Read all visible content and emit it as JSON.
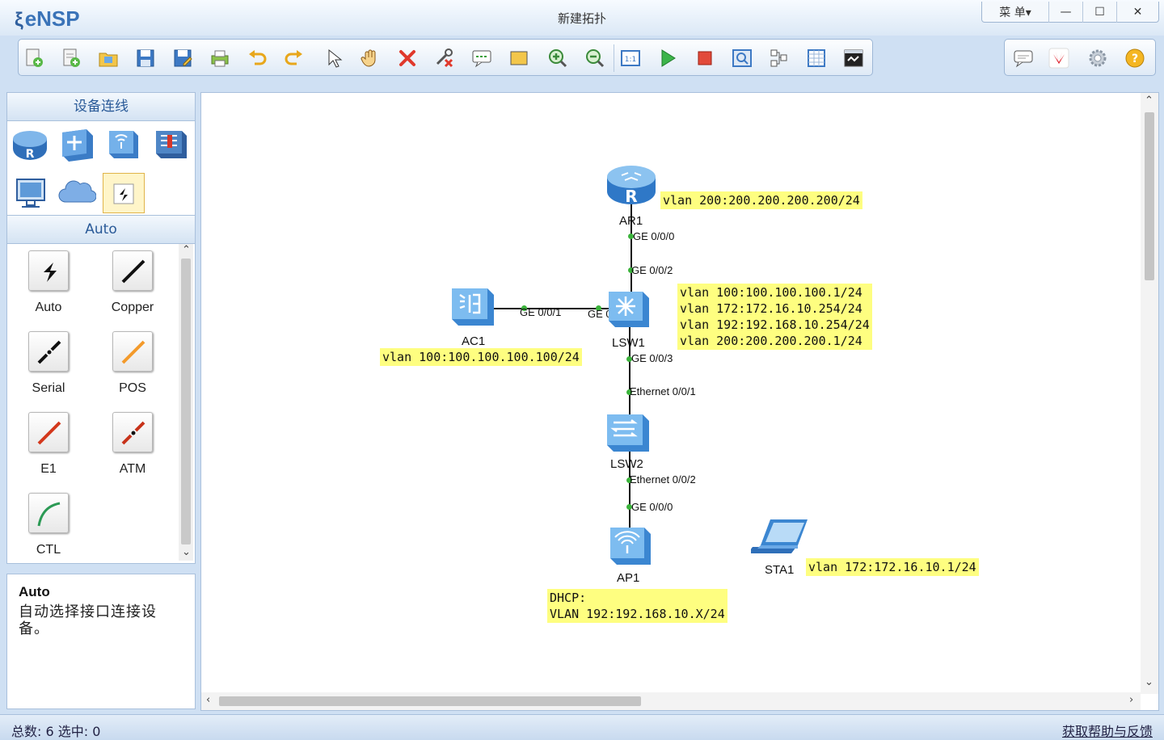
{
  "app": {
    "name": "eNSP",
    "window_title": "新建拓扑"
  },
  "window_controls": {
    "menu_label": "菜 单▾",
    "minimize": "—",
    "maximize": "☐",
    "close": "✕"
  },
  "toolbar": {
    "buttons": [
      "new-topology-icon",
      "new-example-icon",
      "open-icon",
      "save-icon",
      "save-as-icon",
      "print-icon",
      "undo-icon",
      "redo-icon",
      "select-icon",
      "pan-hand-icon",
      "delete-icon",
      "delete-connection-icon",
      "add-text-icon",
      "add-shape-icon",
      "zoom-in-icon",
      "zoom-out-icon",
      "fit-icon",
      "start-device-icon",
      "stop-device-icon",
      "capture-icon",
      "topology-tree-icon",
      "grid-icon",
      "console-icon"
    ],
    "right_buttons": [
      "chat-icon",
      "huawei-icon",
      "settings-icon",
      "help-icon"
    ]
  },
  "left_panel": {
    "header": "设备连线",
    "device_categories": [
      "router-icon",
      "switch-icon",
      "wireless-icon",
      "firewall-icon",
      "pc-icon",
      "cloud-icon",
      "cable-icon"
    ],
    "section_title": "Auto",
    "cables": [
      {
        "label": "Auto",
        "icon": "auto-cable-icon",
        "color": "#111111"
      },
      {
        "label": "Copper",
        "icon": "copper-cable-icon",
        "color": "#111111"
      },
      {
        "label": "Serial",
        "icon": "serial-cable-icon",
        "color": "#111111"
      },
      {
        "label": "POS",
        "icon": "pos-cable-icon",
        "color": "#f39a2b"
      },
      {
        "label": "E1",
        "icon": "e1-cable-icon",
        "color": "#d3381c"
      },
      {
        "label": "ATM",
        "icon": "atm-cable-icon",
        "color": "#c7321a"
      },
      {
        "label": "CTL",
        "icon": "ctl-cable-icon",
        "color": "#2c9a55"
      }
    ],
    "description": {
      "title": "Auto",
      "text": "自动选择接口连接设备。"
    }
  },
  "topology": {
    "devices": [
      {
        "label": "AR1",
        "type": "router"
      },
      {
        "label": "LSW1",
        "type": "core-switch"
      },
      {
        "label": "AC1",
        "type": "access-controller"
      },
      {
        "label": "LSW2",
        "type": "switch"
      },
      {
        "label": "AP1",
        "type": "access-point"
      },
      {
        "label": "STA1",
        "type": "station"
      }
    ],
    "ports": {
      "ar1_lsw1_a": "GE 0/0/0",
      "ar1_lsw1_b": "GE 0/0/2",
      "ac1_lsw1_a": "GE 0/0/1",
      "ac1_lsw1_b": "GE 0/0/1",
      "lsw1_lsw2_a": "GE 0/0/3",
      "lsw1_lsw2_b": "Ethernet 0/0/1",
      "lsw2_ap1_a": "Ethernet 0/0/2",
      "lsw2_ap1_b": "GE 0/0/0"
    },
    "notes": {
      "ar1": "vlan 200:200.200.200.200/24",
      "lsw1": "vlan 100:100.100.100.1/24\nvlan 172:172.16.10.254/24\nvlan 192:192.168.10.254/24\nvlan 200:200.200.200.1/24",
      "ac1": "vlan 100:100.100.100.100/24",
      "ap1": "DHCP:\nVLAN 192:192.168.10.X/24",
      "sta1": "vlan 172:172.16.10.1/24"
    }
  },
  "status": {
    "text": "总数: 6  选中: 0",
    "link": "获取帮助与反馈"
  }
}
